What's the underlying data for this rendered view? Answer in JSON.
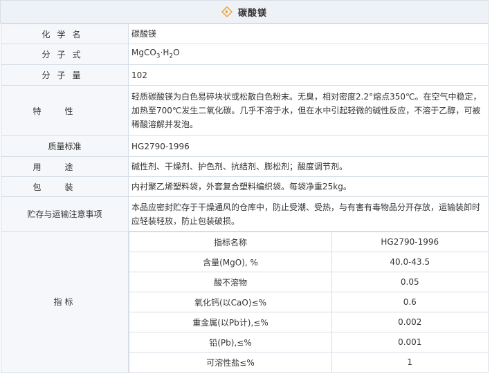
{
  "title": "碳酸镁",
  "rows": {
    "chem_name": {
      "label": "化学名",
      "value": "碳酸镁"
    },
    "formula": {
      "label": "分子式",
      "mg": "MgCO",
      "sub1": "3",
      "dot": "·H",
      "sub2": "2",
      "o": "O"
    },
    "weight": {
      "label": "分子量",
      "value": "102"
    },
    "property": {
      "label": "特性",
      "value": "轻质碳酸镁为白色易碎块状或松散白色粉末。无臭，相对密度2.2°熔点350℃。在空气中稳定，加热至700℃发生二氧化碳。几乎不溶于水，但在水中引起轻微的碱性反应，不溶于乙醇，可被稀酸溶解并发泡。"
    },
    "standard": {
      "label": "质量标准",
      "value": "HG2790-1996"
    },
    "usage": {
      "label": "用途",
      "value": "碱性剂、干燥剂、护色剂、抗结剂、膨松剂；酸度调节剂。"
    },
    "package": {
      "label": "包装",
      "value": "内衬聚乙烯塑料袋，外套复合塑料编织袋。每袋净重25kg。"
    },
    "storage": {
      "label": "贮存与运输注意事项",
      "value": "本品应密封贮存于干燥通风的仓库中，防止受潮、受热，与有害有毒物品分开存放，运输装卸时应轻装轻放，防止包装破损。"
    },
    "indicators_label": "指标"
  },
  "indicators": [
    {
      "name": "指标名称",
      "value": "HG2790-1996"
    },
    {
      "name": "含量(MgO), %",
      "value": "40.0-43.5"
    },
    {
      "name": "酸不溶物",
      "value": "0.05"
    },
    {
      "name": "氧化钙(以CaO)≤%",
      "value": "0.6"
    },
    {
      "name": "重金属(以Pb计),≤%",
      "value": "0.002"
    },
    {
      "name": "铅(Pb),≤%",
      "value": "0.001"
    },
    {
      "name": "可溶性盐≤%",
      "value": "1"
    }
  ],
  "colors": {
    "label_bg": "#f5f7fa",
    "border": "#d6dde6",
    "title_bg": "#eef2f7",
    "icon": "#e8a23a"
  },
  "icons": {
    "title": "diamond-arrow-icon"
  }
}
